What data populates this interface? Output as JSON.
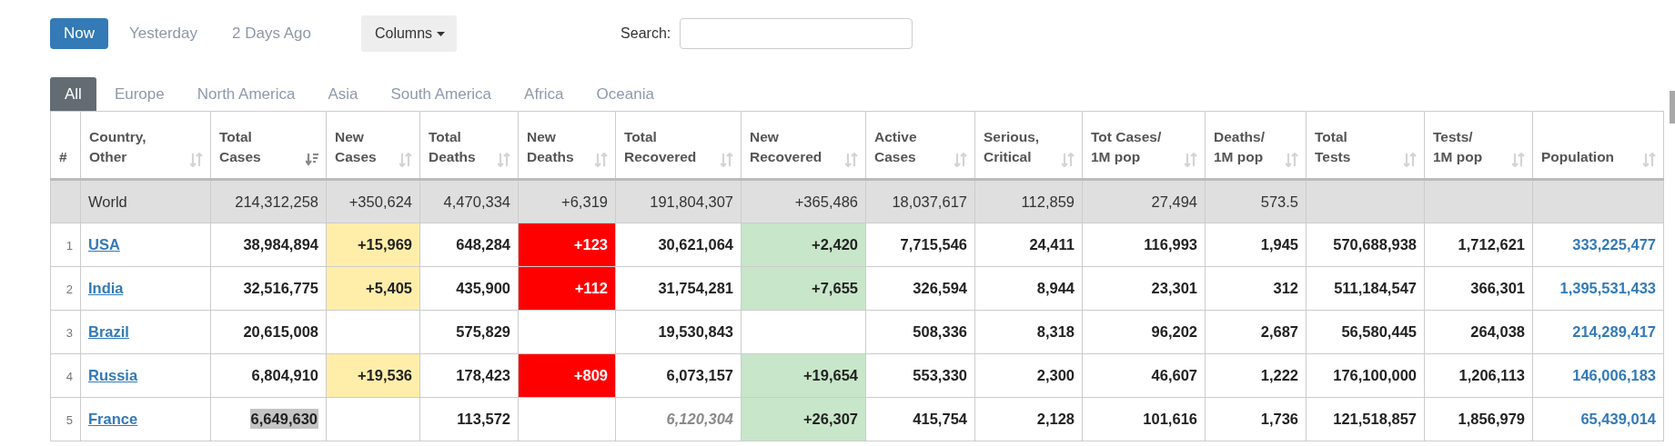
{
  "day_tabs": [
    {
      "label": "Now",
      "selected": true
    },
    {
      "label": "Yesterday",
      "selected": false
    },
    {
      "label": "2 Days Ago",
      "selected": false
    }
  ],
  "columns_button": {
    "label": "Columns"
  },
  "search": {
    "label": "Search:"
  },
  "region_tabs": [
    {
      "label": "All",
      "selected": true
    },
    {
      "label": "Europe",
      "selected": false
    },
    {
      "label": "North America",
      "selected": false
    },
    {
      "label": "Asia",
      "selected": false
    },
    {
      "label": "South America",
      "selected": false
    },
    {
      "label": "Africa",
      "selected": false
    },
    {
      "label": "Oceania",
      "selected": false
    }
  ],
  "table": {
    "columns": [
      {
        "lines": [
          "#"
        ],
        "kind": "rank"
      },
      {
        "lines": [
          "Country,",
          "Other"
        ],
        "kind": "country",
        "sorted": false
      },
      {
        "lines": [
          "Total",
          "Cases"
        ],
        "kind": "number",
        "sorted": true
      },
      {
        "lines": [
          "New",
          "Cases"
        ],
        "kind": "new_cases",
        "sorted": false
      },
      {
        "lines": [
          "Total",
          "Deaths"
        ],
        "kind": "number",
        "sorted": false
      },
      {
        "lines": [
          "New",
          "Deaths"
        ],
        "kind": "new_deaths",
        "sorted": false
      },
      {
        "lines": [
          "Total",
          "Recovered"
        ],
        "kind": "number",
        "sorted": false
      },
      {
        "lines": [
          "New",
          "Recovered"
        ],
        "kind": "new_recovered",
        "sorted": false
      },
      {
        "lines": [
          "Active",
          "Cases"
        ],
        "kind": "number",
        "sorted": false
      },
      {
        "lines": [
          "Serious,",
          "Critical"
        ],
        "kind": "number",
        "sorted": false
      },
      {
        "lines": [
          "Tot Cases/",
          "1M pop"
        ],
        "kind": "number",
        "sorted": false
      },
      {
        "lines": [
          "Deaths/",
          "1M pop"
        ],
        "kind": "number",
        "sorted": false
      },
      {
        "lines": [
          "Total",
          "Tests"
        ],
        "kind": "number",
        "sorted": false
      },
      {
        "lines": [
          "Tests/",
          "1M pop"
        ],
        "kind": "number",
        "sorted": false
      },
      {
        "lines": [
          "Population"
        ],
        "kind": "population",
        "sorted": false
      }
    ],
    "rows": [
      {
        "kind": "total",
        "cells": [
          "",
          "World",
          "214,312,258",
          "+350,624",
          "4,470,334",
          "+6,319",
          "191,804,307",
          "+365,486",
          "18,037,617",
          "112,859",
          "27,494",
          "573.5",
          "",
          "",
          ""
        ]
      },
      {
        "kind": "country",
        "cells": [
          "1",
          "USA",
          "38,984,894",
          "+15,969",
          "648,284",
          "+123",
          "30,621,064",
          "+2,420",
          "7,715,546",
          "24,411",
          "116,993",
          "1,945",
          "570,688,938",
          "1,712,621",
          "333,225,477"
        ]
      },
      {
        "kind": "country",
        "cells": [
          "2",
          "India",
          "32,516,775",
          "+5,405",
          "435,900",
          "+112",
          "31,754,281",
          "+7,655",
          "326,594",
          "8,944",
          "23,301",
          "312",
          "511,184,547",
          "366,301",
          "1,395,531,433"
        ]
      },
      {
        "kind": "country",
        "cells": [
          "3",
          "Brazil",
          "20,615,008",
          "",
          "575,829",
          "",
          "19,530,843",
          "",
          "508,336",
          "8,318",
          "96,202",
          "2,687",
          "56,580,445",
          "264,038",
          "214,289,417"
        ]
      },
      {
        "kind": "country",
        "cells": [
          "4",
          "Russia",
          "6,804,910",
          "+19,536",
          "178,423",
          "+809",
          "6,073,157",
          "+19,654",
          "553,330",
          "2,300",
          "46,607",
          "1,222",
          "176,100,000",
          "1,206,113",
          "146,006,183"
        ]
      },
      {
        "kind": "country",
        "cells": [
          "5",
          "France",
          {
            "text": "6,649,630",
            "highlighted": true,
            "estimated": false
          },
          "",
          "113,572",
          "",
          {
            "text": "6,120,304",
            "highlighted": false,
            "estimated": true
          },
          "+26,307",
          "415,754",
          "2,128",
          "101,616",
          "1,736",
          "121,518,857",
          "1,856,979",
          "65,439,014"
        ]
      }
    ]
  }
}
